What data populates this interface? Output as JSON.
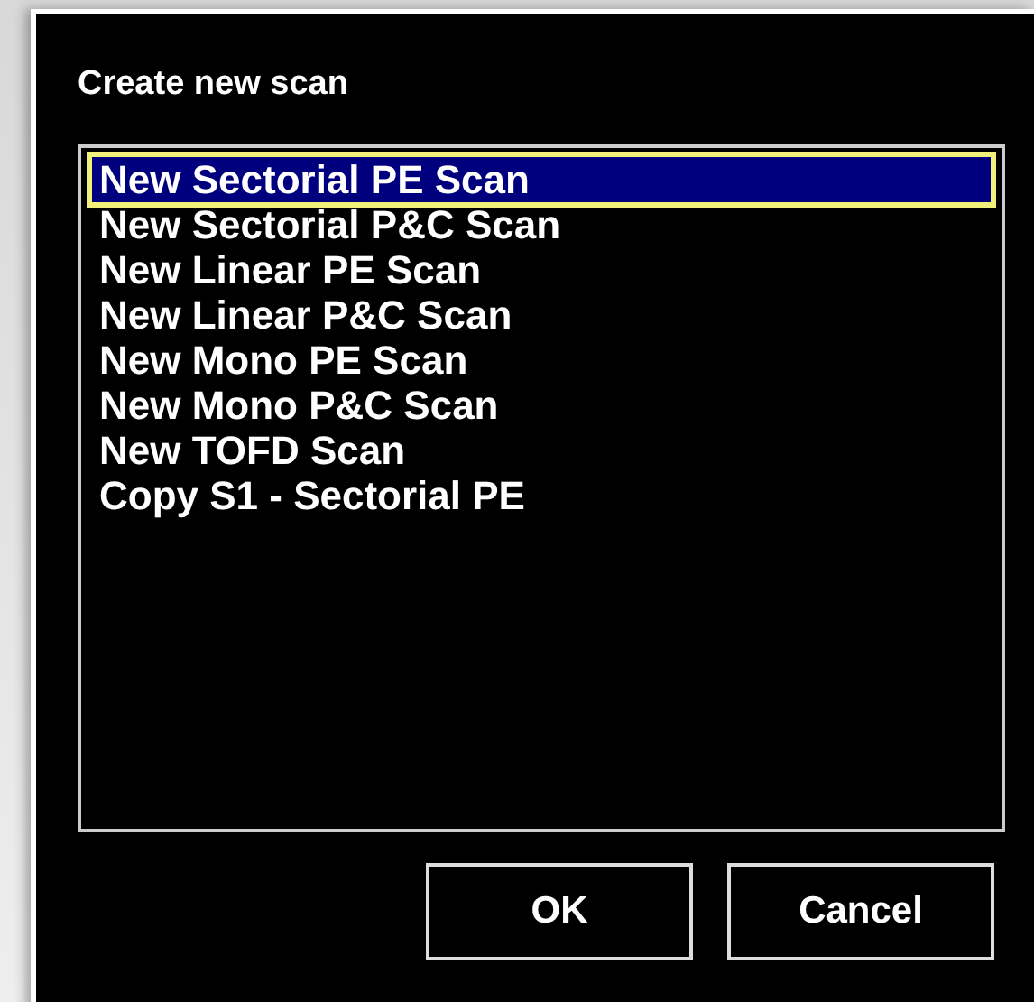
{
  "dialog": {
    "title": "Create new scan"
  },
  "list": {
    "items": [
      {
        "label": "New Sectorial PE Scan",
        "selected": true
      },
      {
        "label": "New Sectorial P&C Scan",
        "selected": false
      },
      {
        "label": "New Linear PE Scan",
        "selected": false
      },
      {
        "label": "New Linear P&C Scan",
        "selected": false
      },
      {
        "label": "New Mono PE Scan",
        "selected": false
      },
      {
        "label": "New Mono P&C Scan",
        "selected": false
      },
      {
        "label": "New TOFD Scan",
        "selected": false
      },
      {
        "label": "Copy S1 - Sectorial PE",
        "selected": false
      }
    ]
  },
  "buttons": [
    "OK",
    "Cancel"
  ]
}
